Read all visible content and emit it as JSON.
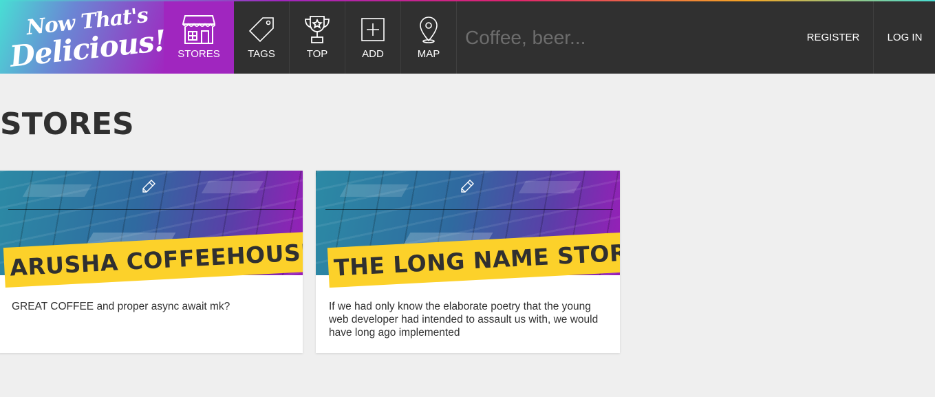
{
  "brand": {
    "line1": "Now That's",
    "line2": "Delicious!"
  },
  "nav": {
    "items": [
      {
        "label": "STORES",
        "icon": "store-icon",
        "active": true
      },
      {
        "label": "TAGS",
        "icon": "tag-icon"
      },
      {
        "label": "TOP",
        "icon": "trophy-icon"
      },
      {
        "label": "ADD",
        "icon": "add-icon"
      },
      {
        "label": "MAP",
        "icon": "map-pin-icon"
      }
    ],
    "search_placeholder": "Coffee, beer...",
    "register": "REGISTER",
    "login": "LOG IN"
  },
  "page": {
    "title": "STORES"
  },
  "stores": [
    {
      "name": "ARUSHA COFFEEHOUSE",
      "description": "GREAT COFFEE and proper async await mk?"
    },
    {
      "name": "THE LONG NAME STORE",
      "description": "If we had only know the elaborate poetry that the young web developer had intended to assault us with, we would have long ago implemented"
    }
  ],
  "colors": {
    "accent": "#a026bf",
    "nav_bg": "#303030",
    "banner": "#fcd12a",
    "page_bg": "#efefef"
  }
}
